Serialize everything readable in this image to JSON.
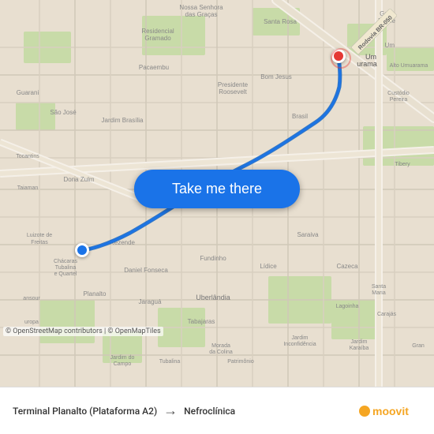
{
  "map": {
    "background_color": "#e8e0d8",
    "attribution": "© OpenStreetMap contributors | © OpenMapTiles"
  },
  "button": {
    "label": "Take me there"
  },
  "footer": {
    "origin": "Terminal Planalto (Plataforma A2)",
    "arrow": "→",
    "destination": "Nefroclínica",
    "logo": "moovit"
  },
  "markers": {
    "origin_color": "#1a73e8",
    "destination_color": "#e53935"
  }
}
